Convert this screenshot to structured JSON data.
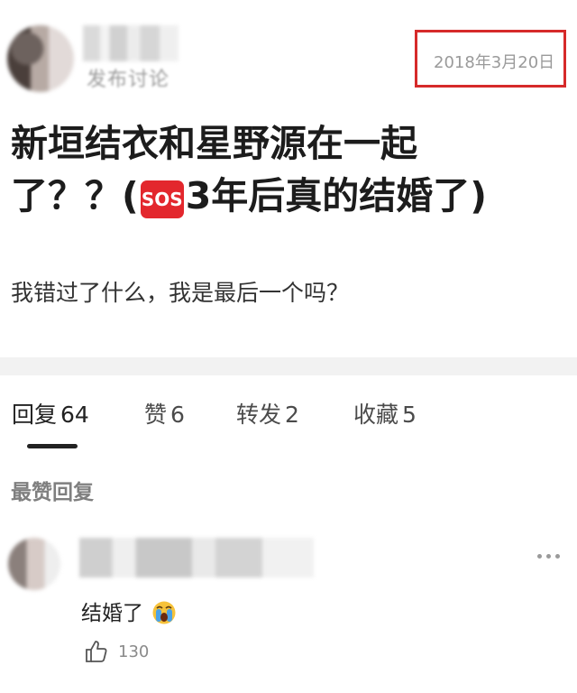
{
  "post": {
    "kind_label": "发布讨论",
    "date": "2018年3月20日",
    "title_line1": "新垣结衣和星野源在一起",
    "title_line2_prefix": "了？？(",
    "title_sos": "SOS",
    "title_line2_suffix": "3年后真的结婚了)",
    "body": "我错过了什么，我是最后一个吗？"
  },
  "tabs": [
    {
      "label": "回复",
      "count": "64"
    },
    {
      "label": "赞",
      "count": "6"
    },
    {
      "label": "转发",
      "count": "2"
    },
    {
      "label": "收藏",
      "count": "5"
    }
  ],
  "section_title": "最赞回复",
  "comment": {
    "text": "结婚了",
    "likes": "130",
    "emoji_icon": "crying-face-icon"
  },
  "colors": {
    "highlight_box": "#d62a2a",
    "sos_badge": "#e3272d",
    "band": "#f2f2f2"
  }
}
